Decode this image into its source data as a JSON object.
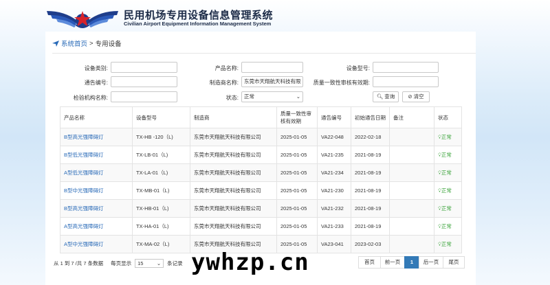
{
  "header": {
    "title": "民用机场专用设备信息管理系统",
    "subtitle": "Civilian Airport Equipment Information Management System"
  },
  "breadcrumb": {
    "home": "系统首页",
    "sep": ">",
    "current": "专用设备"
  },
  "filters": {
    "device_category_label": "设备类别:",
    "device_category_value": "",
    "product_name_label": "产品名称:",
    "product_name_value": "",
    "device_model_label": "设备型号:",
    "device_model_value": "",
    "notice_no_label": "通告编号:",
    "notice_no_value": "",
    "manufacturer_label": "制造商名称:",
    "manufacturer_value": "东莞市天翔航天科技有限",
    "validity_label": "质量一致性审核有效期:",
    "validity_value": "",
    "inspection_label": "检验机构名称:",
    "inspection_value": "",
    "status_label": "状态:",
    "status_value": "正常",
    "search_button": "查询",
    "clear_button": "清空"
  },
  "table": {
    "headers": [
      "产品名称",
      "设备型号",
      "制造商",
      "质量一致性审核有效期",
      "通告编号",
      "初始通告日期",
      "备注",
      "状态"
    ],
    "rows": [
      {
        "name": "B型高光强障碍灯",
        "model": "TX-HB -120（L)",
        "maker": "东莞市天翔航天科技有限公司",
        "valid": "2025-01-05",
        "notice": "VA22-048",
        "date": "2022-02-18",
        "note": "",
        "status": "正常"
      },
      {
        "name": "B型低光强障碍灯",
        "model": "TX-LB-01（L)",
        "maker": "东莞市天翔航天科技有限公司",
        "valid": "2025-01-05",
        "notice": "VA21-235",
        "date": "2021-08-19",
        "note": "",
        "status": "正常"
      },
      {
        "name": "A型低光强障碍灯",
        "model": "TX-LA-01（L)",
        "maker": "东莞市天翔航天科技有限公司",
        "valid": "2025-01-05",
        "notice": "VA21-234",
        "date": "2021-08-19",
        "note": "",
        "status": "正常"
      },
      {
        "name": "B型中光强障碍灯",
        "model": "TX-MB-01（L)",
        "maker": "东莞市天翔航天科技有限公司",
        "valid": "2025-01-05",
        "notice": "VA21-230",
        "date": "2021-08-19",
        "note": "",
        "status": "正常"
      },
      {
        "name": "B型高光强障碍灯",
        "model": "TX-HB-01（L)",
        "maker": "东莞市天翔航天科技有限公司",
        "valid": "2025-01-05",
        "notice": "VA21-232",
        "date": "2021-08-19",
        "note": "",
        "status": "正常"
      },
      {
        "name": "A型高光强障碍灯",
        "model": "TX-HA-01（L)",
        "maker": "东莞市天翔航天科技有限公司",
        "valid": "2025-01-05",
        "notice": "VA21-233",
        "date": "2021-08-19",
        "note": "",
        "status": "正常"
      },
      {
        "name": "A型中光强障碍灯",
        "model": "TX-MA-02（L)",
        "maker": "东莞市天翔航天科技有限公司",
        "valid": "2025-01-05",
        "notice": "VA23-041",
        "date": "2023-02-03",
        "note": "",
        "status": "正常"
      }
    ]
  },
  "footer": {
    "range_text": "从 1 到 7 /共 7 条数据",
    "per_page_label": "每页显示",
    "per_page_value": "15",
    "records_label": "条记录",
    "pager": {
      "first": "首页",
      "prev": "前一页",
      "current": "1",
      "next": "后一页",
      "last": "尾页"
    }
  },
  "watermark": "ywhzp.cn",
  "colors": {
    "link": "#2a6bb8",
    "status_ok": "#3aa33a",
    "pager_active": "#337ab7",
    "title": "#1b2a46"
  }
}
